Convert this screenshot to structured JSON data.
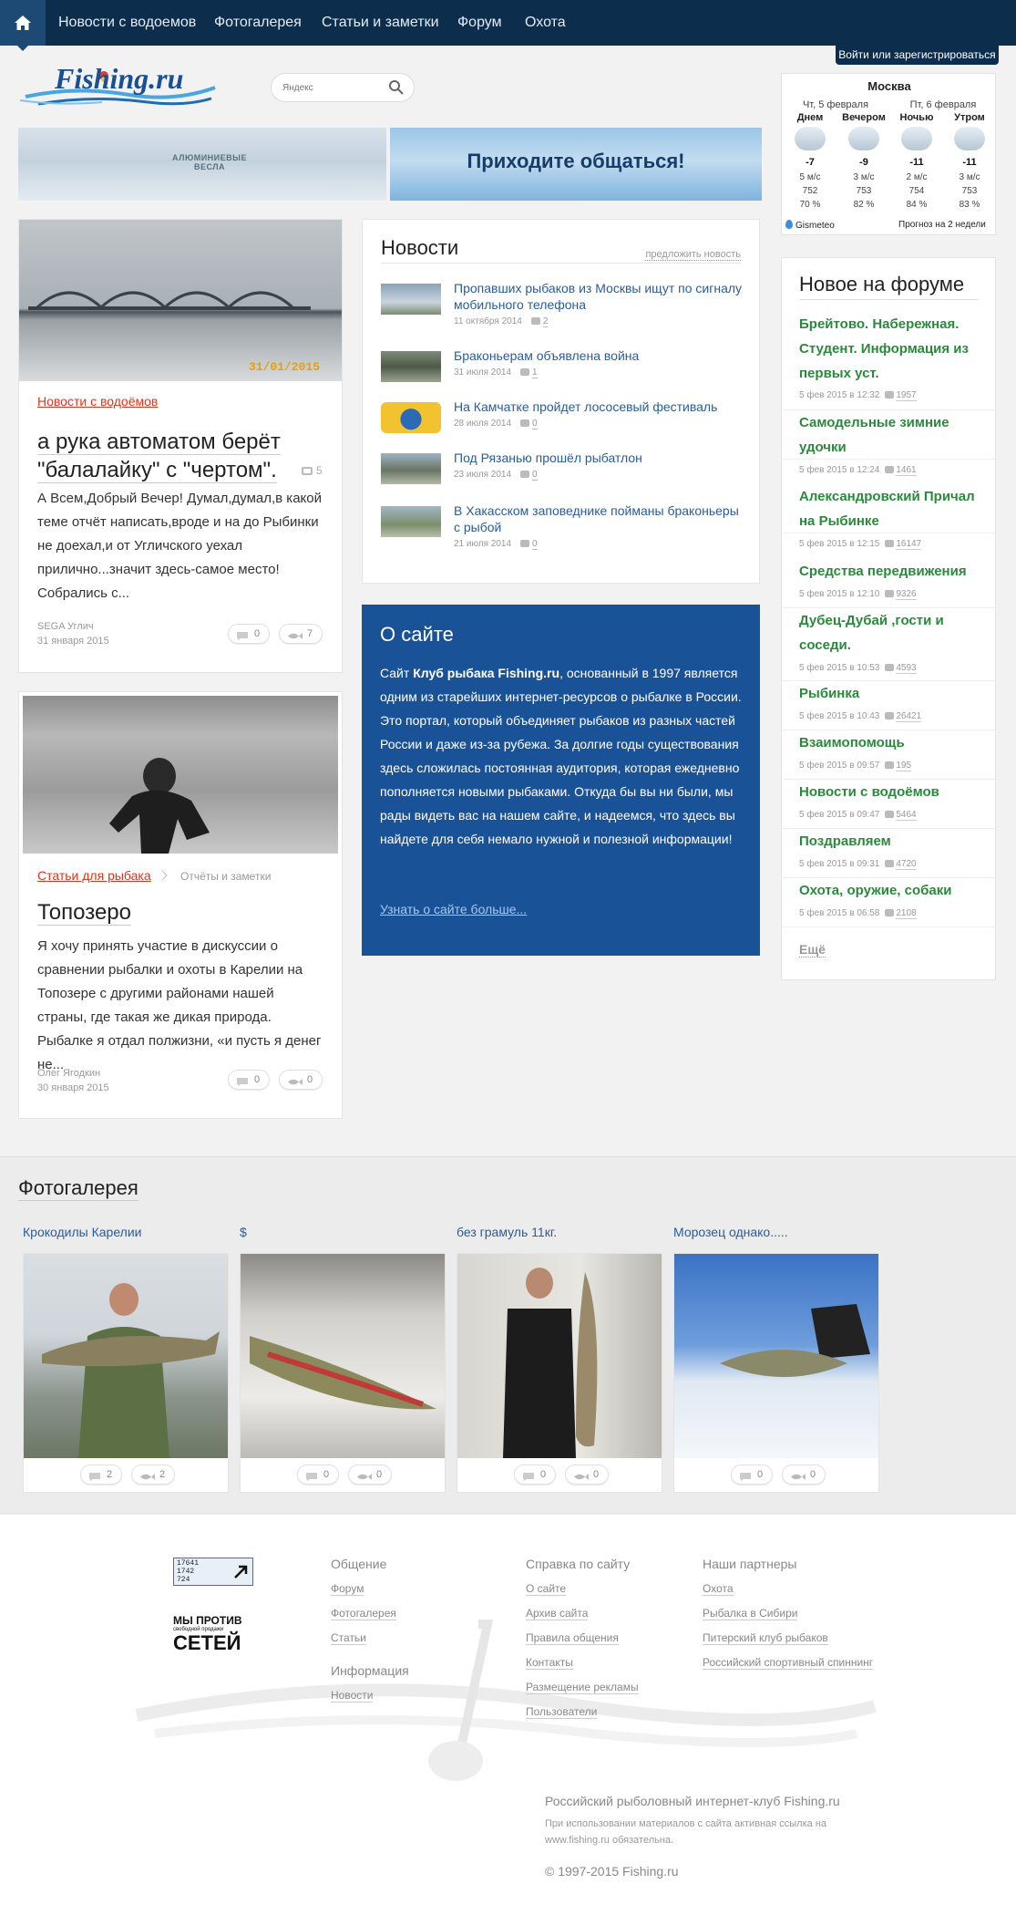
{
  "nav": {
    "home_icon": "home-icon",
    "items": [
      "Новости с водоемов",
      "Фотогалерея",
      "Статьи и заметки",
      "Форум",
      "Охота"
    ],
    "login": "Войти или зарегистрироваться"
  },
  "logo": {
    "text": "Fishing.ru"
  },
  "search": {
    "placeholder": "Яндекс",
    "icon": "search-icon"
  },
  "banners": {
    "left_text": "АЛЮМИНИЕВЫЕ ВЕСЛА",
    "right_text": "Приходите общаться!"
  },
  "weather": {
    "city": "Москва",
    "day1": "Чт, 5 февраля",
    "day2": "Пт, 6 февраля",
    "periods": [
      {
        "name": "Днем",
        "temp": "-7",
        "wind": "5 м/с",
        "pressure": "752",
        "humidity": "70 %"
      },
      {
        "name": "Вечером",
        "temp": "-9",
        "wind": "3 м/с",
        "pressure": "753",
        "humidity": "82 %"
      },
      {
        "name": "Ночью",
        "temp": "-11",
        "wind": "2 м/с",
        "pressure": "754",
        "humidity": "84 %"
      },
      {
        "name": "Утром",
        "temp": "-11",
        "wind": "3 м/с",
        "pressure": "753",
        "humidity": "83 %"
      }
    ],
    "provider": "Gismeteo",
    "forecast_link": "Прогноз на 2 недели"
  },
  "cards": [
    {
      "category": "Новости с водоёмов",
      "subcategory": "",
      "photo_date": "31/01/2015",
      "title_lines": [
        "а рука автоматом берёт",
        "\"балалайку\" с \"чертом\"."
      ],
      "photo_count": "5",
      "text": "А Всем,Добрый Вечер! Думал,думал,в какой теме отчёт написать,вроде и на до Рыбинки не доехал,и от Угличского уехал прилично...значит здесь-самое место! Собрались с...",
      "author": "SEGA Углич",
      "date": "31 января 2015",
      "comments": "0",
      "likes": "7"
    },
    {
      "category": "Статьи для рыбака",
      "subcategory": "Отчёты и заметки",
      "title_lines": [
        "Топозеро"
      ],
      "text": "Я хочу принять участие в дискуссии о сравнении рыбалки и охоты в Карелии на Топозере с другими районами нашей страны, где такая же дикая природа. Рыбалке я отдал полжизни, «и пусть я денег не...",
      "author": "Олег Ягодкин",
      "date": "30 января 2015",
      "comments": "0",
      "likes": "0"
    }
  ],
  "news": {
    "title": "Новости",
    "suggest": "предложить новость",
    "items": [
      {
        "title": "Пропавших рыбаков из Москвы ищут по сигналу мобильного телефона",
        "date": "11 октября 2014",
        "comments": "2"
      },
      {
        "title": "Браконьерам объявлена война",
        "date": "31 июля 2014",
        "comments": "1"
      },
      {
        "title": "На Камчатке пройдет лососевый фестиваль",
        "date": "28 июля 2014",
        "comments": "0"
      },
      {
        "title": "Под Рязанью прошёл рыбатлон",
        "date": "23 июля 2014",
        "comments": "0"
      },
      {
        "title": "В Хакасском заповеднике пойманы браконьеры с рыбой",
        "date": "21 июля 2014",
        "comments": "0"
      }
    ]
  },
  "about": {
    "title": "О сайте",
    "text_pre": "Сайт ",
    "text_bold": "Клуб рыбака Fishing.ru",
    "text_post": ", основанный в 1997 является одним из старейших интернет-ресурсов о рыбалке в России. Это портал, который объединяет рыбаков из разных частей России и даже из-за рубежа. За долгие годы существования здесь сложилась постоянная аудитория, которая ежедневно пополняется новыми рыбаками. Откуда бы вы ни были, мы рады видеть вас на нашем сайте, и надеемся, что здесь вы найдете для себя немало нужной и полезной информации!",
    "more": "Узнать о сайте больше..."
  },
  "forum": {
    "title": "Новое на форуме",
    "items": [
      {
        "title": "Брейтово. Набережная. Студент. Информация из первых уст.",
        "date": "5 фев 2015 в 12:32",
        "count": "1957"
      },
      {
        "title": "Самодельные зимние удочки",
        "date": "5 фев 2015 в 12:24",
        "count": "1461"
      },
      {
        "title": "Александровский Причал на Рыбинке",
        "date": "5 фев 2015 в 12:15",
        "count": "16147"
      },
      {
        "title": "Средства передвижения",
        "date": "5 фев 2015 в 12:10",
        "count": "9326"
      },
      {
        "title": "Дубец-Дубай ,гости и соседи.",
        "date": "5 фев 2015 в 10:53",
        "count": "4593"
      },
      {
        "title": "Рыбинка",
        "date": "5 фев 2015 в 10:43",
        "count": "26421"
      },
      {
        "title": "Взаимопомощь",
        "date": "5 фев 2015 в 09:57",
        "count": "195"
      },
      {
        "title": "Новости с водоёмов",
        "date": "5 фев 2015 в 09:47",
        "count": "5464"
      },
      {
        "title": "Поздравляем",
        "date": "5 фев 2015 в 09:31",
        "count": "4720"
      },
      {
        "title": "Охота, оружие, собаки",
        "date": "5 фев 2015 в 06:58",
        "count": "2108"
      }
    ],
    "more": "Ещё"
  },
  "gallery": {
    "title": "Фотогалерея",
    "items": [
      {
        "title": "Крокодилы Карелии",
        "comments": "2",
        "likes": "2"
      },
      {
        "title": "$",
        "comments": "0",
        "likes": "0"
      },
      {
        "title": "без грамуль 11кг.",
        "comments": "0",
        "likes": "0"
      },
      {
        "title": "Морозец однако.....",
        "comments": "0",
        "likes": "0"
      }
    ]
  },
  "footer": {
    "counter": [
      "17641",
      "1742",
      "724"
    ],
    "badge_lines": [
      "МЫ ПРОТИВ",
      "свободной продажи",
      "СЕТЕЙ"
    ],
    "col1": {
      "title": "Общение",
      "links": [
        "Форум",
        "Фотогалерея",
        "Статьи"
      ]
    },
    "col1b": {
      "title": "Информация",
      "links": [
        "Новости"
      ]
    },
    "col2": {
      "title": "Справка по сайту",
      "links": [
        "О сайте",
        "Архив сайта",
        "Правила общения",
        "Контакты",
        "Размещение рекламы",
        "Пользователи"
      ]
    },
    "col3": {
      "title": "Наши партнеры",
      "links": [
        "Охота",
        "Рыбалка в Сибири",
        "Питерский клуб рыбаков",
        "Российский спортивный спиннинг"
      ]
    },
    "club": "Российский рыболовный интернет-клуб Fishing.ru",
    "notice_line1": "При использовании материалов с сайта активная ссылка на",
    "notice_line2": "www.fishing.ru обязательна.",
    "copyright": "© 1997-2015 Fishing.ru"
  }
}
